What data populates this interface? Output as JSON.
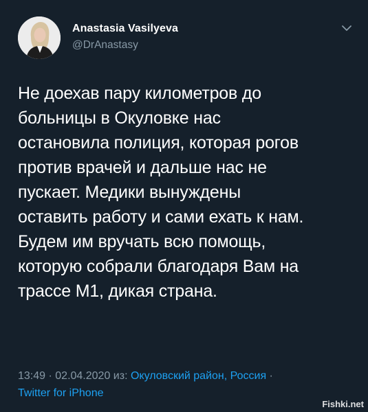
{
  "author": {
    "name": "Anastasia Vasilyeva",
    "handle": "@DrAnastasy"
  },
  "tweet": {
    "text": "Не доехав пару километров до\nбольницы в Окуловке нас\nостановила полиция, которая рогов\nпротив врачей и дальше нас не\nпускает. Медики вынуждены\nоставить работу и сами ехать к нам.\nБудем им вручать всю помощь,\nкоторую собрали благодаря Вам на\nтрассе М1, дикая страна."
  },
  "meta": {
    "time": "13:49",
    "separator": " · ",
    "date": "02.04.2020",
    "from_label": " из: ",
    "location": "Окуловский район, Россия",
    "trailing_dot": " ·",
    "source": "Twitter for iPhone"
  },
  "watermark": "Fishki.net",
  "icons": {
    "menu": "chevron-down-icon"
  },
  "colors": {
    "background": "#15202b",
    "secondary_text": "#8899a6",
    "link": "#1da1f2"
  }
}
